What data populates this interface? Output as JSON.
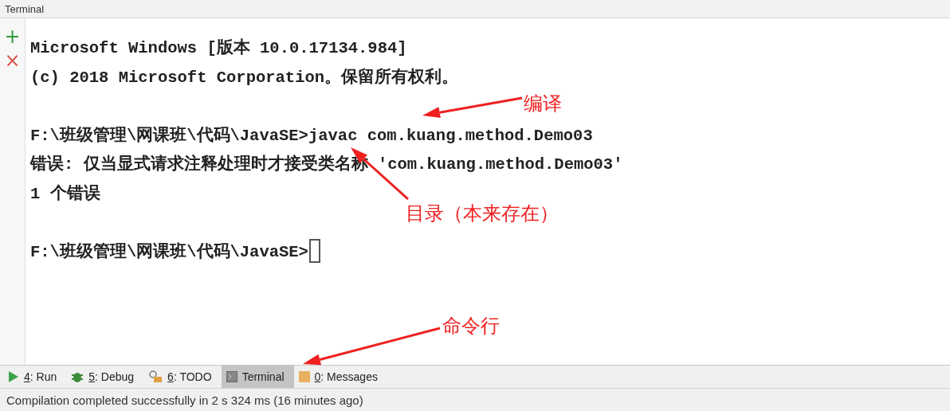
{
  "panel_title": "Terminal",
  "gutter_buttons": [
    {
      "kind": "add",
      "label": "+"
    },
    {
      "kind": "close",
      "label": "×"
    }
  ],
  "lines": [
    {
      "kind": "output",
      "text": "Microsoft Windows [版本 10.0.17134.984]"
    },
    {
      "kind": "output",
      "text": "(c) 2018 Microsoft Corporation。保留所有权利。"
    },
    {
      "kind": "blank"
    },
    {
      "kind": "output",
      "text": "F:\\班级管理\\网课班\\代码\\JavaSE>javac com.kuang.method.Demo03"
    },
    {
      "kind": "output",
      "text": "错误: 仅当显式请求注释处理时才接受类名称 'com.kuang.method.Demo03'"
    },
    {
      "kind": "output",
      "text": "1 个错误"
    },
    {
      "kind": "blank"
    },
    {
      "kind": "prompt",
      "text": "F:\\班级管理\\网课班\\代码\\JavaSE>"
    }
  ],
  "annotations": [
    "编译",
    "目录（本来存在）",
    "命令行"
  ],
  "tool_tabs": [
    {
      "kind": "run",
      "mnemonic": "4",
      "label": ": Run",
      "selected": false
    },
    {
      "kind": "debug",
      "mnemonic": "5",
      "label": ": Debug",
      "selected": false
    },
    {
      "kind": "todo",
      "mnemonic": "6",
      "label": ": TODO",
      "selected": false
    },
    {
      "kind": "terminal",
      "label": "Terminal",
      "selected": true
    },
    {
      "kind": "messages",
      "mnemonic": "0",
      "label": ": Messages",
      "selected": false
    }
  ],
  "status_bar": "Compilation completed successfully in 2 s 324 ms (16 minutes ago)"
}
